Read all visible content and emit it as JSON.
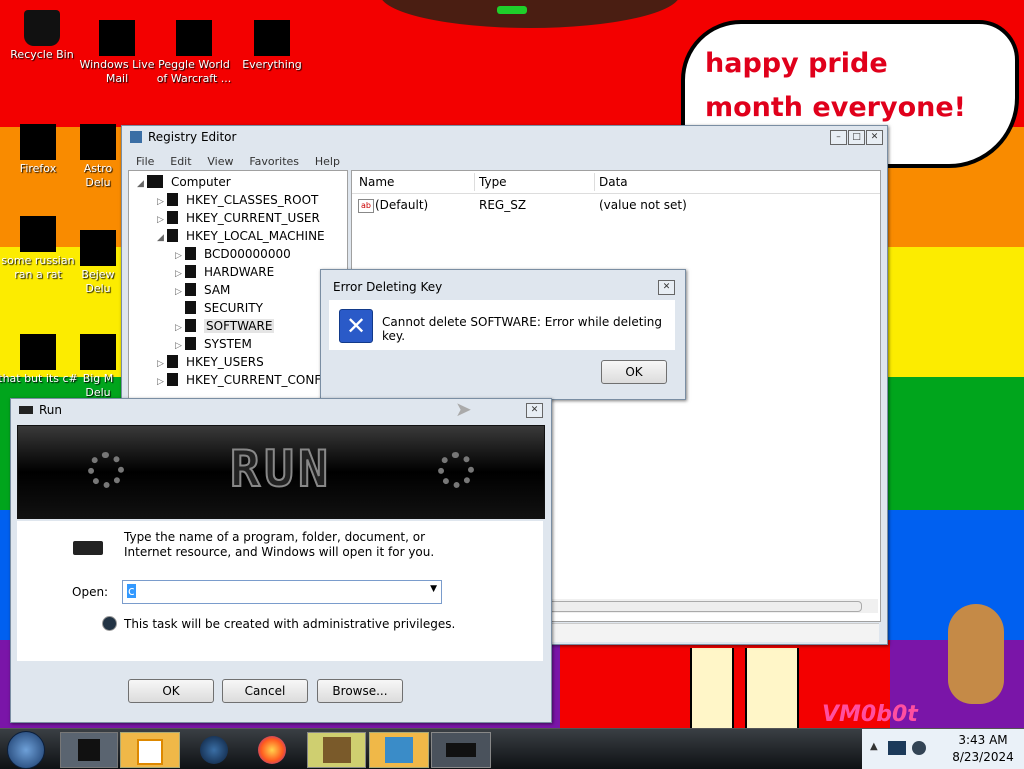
{
  "desktop": {
    "colors": {
      "red": "#f30000",
      "orange": "#f98b00",
      "yellow": "#fcec00",
      "green": "#00a51c",
      "blue": "#0060f0",
      "purple": "#7a15a8"
    },
    "speech_bubble": "happy pride month everyone!",
    "watermark": "VM0b0t",
    "icons": [
      {
        "label": "Recycle Bin",
        "name": "recycle-bin-icon"
      },
      {
        "label": "Windows Live Mail",
        "name": "windows-live-mail-icon"
      },
      {
        "label": "Peggle World of Warcraft ...",
        "name": "peggle-icon"
      },
      {
        "label": "Everything",
        "name": "everything-icon"
      },
      {
        "label": "Firefox",
        "name": "firefox-icon"
      },
      {
        "label": "Astro Delu",
        "name": "astro-icon"
      },
      {
        "label": "some russian ran a rat",
        "name": "russian-rat-icon"
      },
      {
        "label": "Bejew Delu",
        "name": "bejeweled-icon"
      },
      {
        "label": "that but its c#",
        "name": "csharp-icon"
      },
      {
        "label": "Big M Delu",
        "name": "big-m-icon"
      }
    ]
  },
  "registry": {
    "title": "Registry Editor",
    "menu": [
      "File",
      "Edit",
      "View",
      "Favorites",
      "Help"
    ],
    "tree": {
      "root": "Computer",
      "items": [
        "HKEY_CLASSES_ROOT",
        "HKEY_CURRENT_USER",
        "HKEY_LOCAL_MACHINE"
      ],
      "hklm_children": [
        "BCD00000000",
        "HARDWARE",
        "SAM",
        "SECURITY",
        "SOFTWARE",
        "SYSTEM"
      ],
      "after": [
        "HKEY_USERS",
        "HKEY_CURRENT_CONFI"
      ]
    },
    "columns": {
      "name": "Name",
      "type": "Type",
      "data": "Data"
    },
    "row": {
      "name": "(Default)",
      "type": "REG_SZ",
      "data": "(value not set)"
    }
  },
  "error_dialog": {
    "title": "Error Deleting Key",
    "message": "Cannot delete SOFTWARE:  Error while deleting key.",
    "ok": "OK"
  },
  "run": {
    "title": "Run",
    "banner": "RUN",
    "description": "Type the name of a program, folder, document, or Internet resource, and Windows will open it for you.",
    "open_label": "Open:",
    "open_value": "c",
    "admin_note": "This task will be created with administrative privileges.",
    "ok": "OK",
    "cancel": "Cancel",
    "browse": "Browse..."
  },
  "taskbar": {
    "time": "3:43 AM",
    "date": "8/23/2024"
  }
}
